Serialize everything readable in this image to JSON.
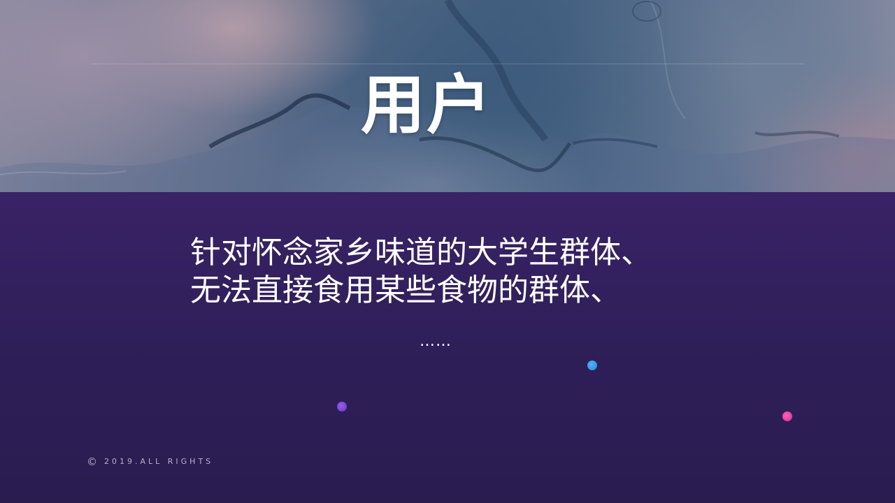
{
  "slide": {
    "title": "用户",
    "body_lines": [
      "针对怀念家乡味道的大学生群体、",
      "无法直接食用某些食物的群体、"
    ],
    "ellipsis": "……",
    "footer": {
      "copyright_icon": "©",
      "text": "2019.ALL RIGHTS"
    }
  },
  "colors": {
    "panel": "#2f1f5a",
    "dot_blue": "#3aa3f0",
    "dot_purple": "#7a45d8",
    "dot_pink": "#f040a0"
  }
}
